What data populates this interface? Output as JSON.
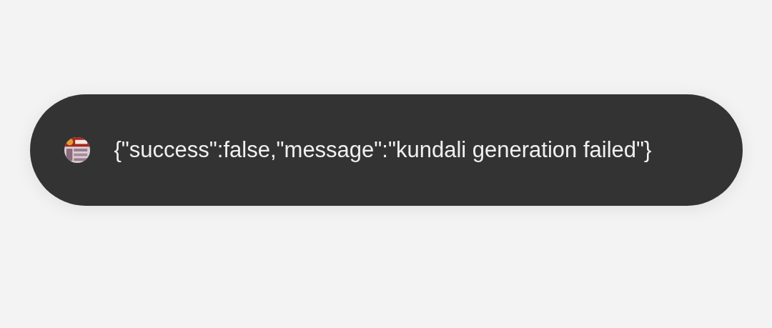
{
  "toast": {
    "message": "{\"success\":false,\"message\":\"kundali generation failed\"}"
  }
}
